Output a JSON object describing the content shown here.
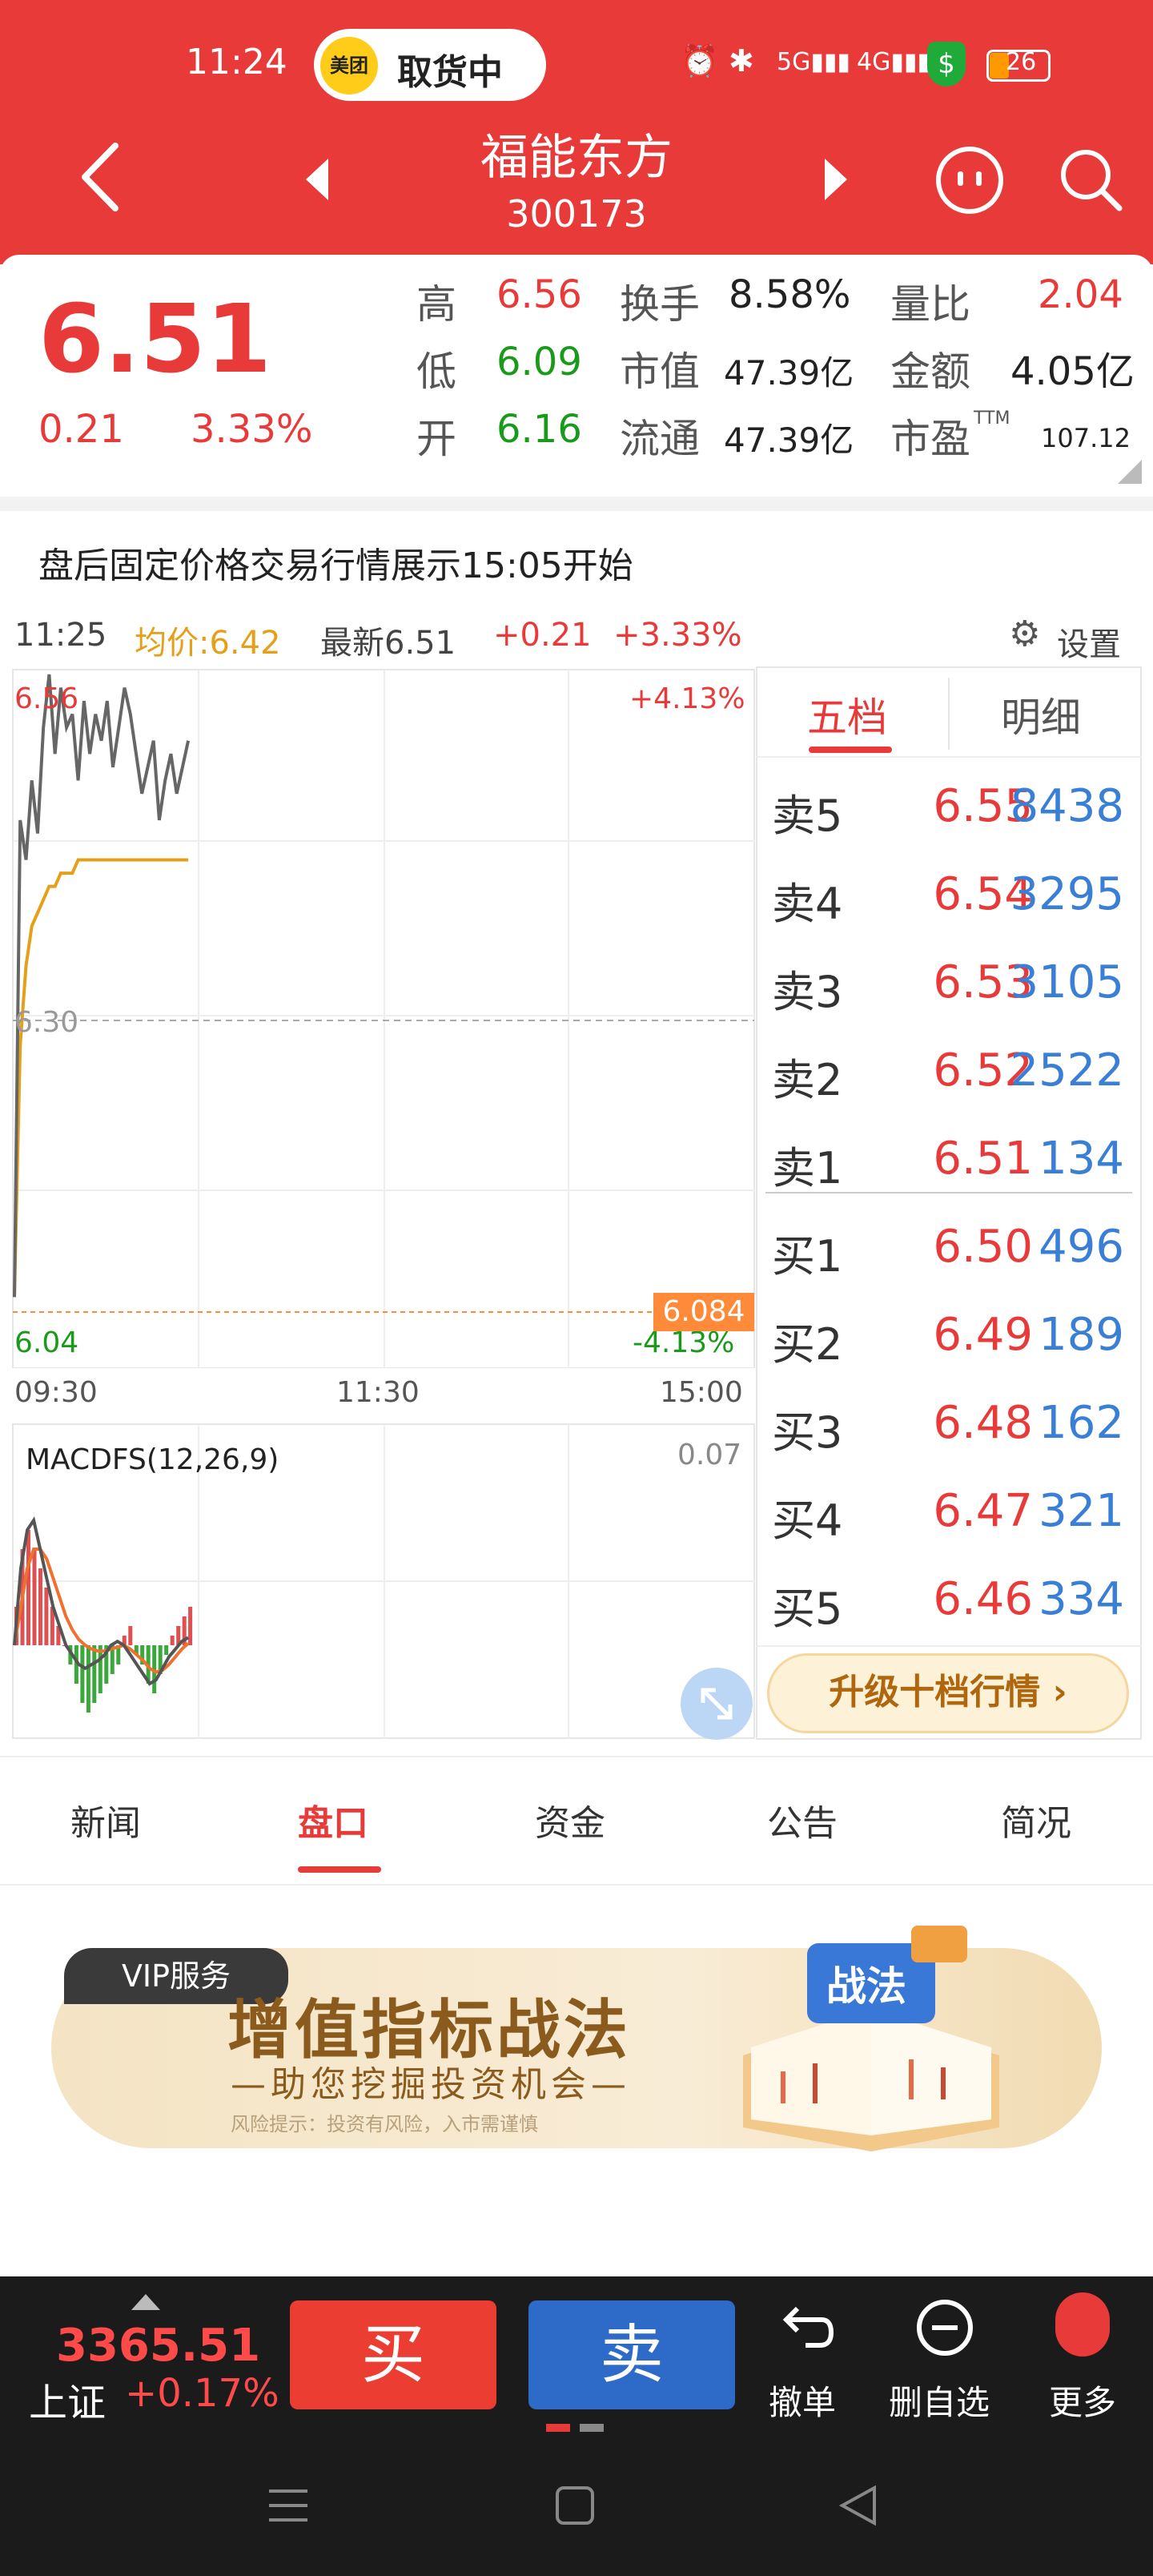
{
  "status_bar": {
    "time": "11:24",
    "pill_logo": "美团",
    "pill_text": "取货中",
    "battery": "26"
  },
  "nav": {
    "title": "福能东方",
    "code": "300173"
  },
  "quote": {
    "price": "6.51",
    "change": "0.21",
    "change_pct": "3.33%",
    "high_label": "高",
    "high": "6.56",
    "low_label": "低",
    "low": "6.09",
    "open_label": "开",
    "open": "6.16",
    "turnover_label": "换手",
    "turnover": "8.58%",
    "mktcap_label": "市值",
    "mktcap": "47.39亿",
    "float_label": "流通",
    "float": "47.39亿",
    "volratio_label": "量比",
    "volratio": "2.04",
    "amount_label": "金额",
    "amount": "4.05亿",
    "pe_label": "市盈",
    "pe_sup": "TTM",
    "pe": "107.12"
  },
  "notice": "盘后固定价格交易行情展示15:05开始",
  "chart_header": {
    "time": "11:25",
    "avg": "均价:6.42",
    "latest": "最新6.51",
    "chg": "+0.21",
    "pct": "+3.33%",
    "settings": "设置"
  },
  "chart_data": {
    "type": "line",
    "title": "",
    "y_top_label": "6.56",
    "y_mid_label": "6.30",
    "y_bottom_label": "6.04",
    "pct_top": "+4.13%",
    "pct_bottom": "-4.13%",
    "ref_price": "6.084",
    "x_ticks": [
      "09:30",
      "11:30",
      "15:00"
    ],
    "ylim": [
      6.04,
      6.56
    ],
    "series": [
      {
        "values": [
          6.09,
          6.45,
          6.42,
          6.48,
          6.44,
          6.52,
          6.56,
          6.5,
          6.55,
          6.52,
          6.53,
          6.48,
          6.54,
          6.5,
          6.53,
          6.51,
          6.54,
          6.49,
          6.52,
          6.55,
          6.53,
          6.5,
          6.47,
          6.49,
          6.51,
          6.45,
          6.48,
          6.5,
          6.47,
          6.49,
          6.51
        ]
      },
      {
        "values": [
          6.09,
          6.28,
          6.34,
          6.37,
          6.38,
          6.39,
          6.4,
          6.4,
          6.41,
          6.41,
          6.41,
          6.42,
          6.42,
          6.42,
          6.42,
          6.42,
          6.42,
          6.42,
          6.42,
          6.42,
          6.42,
          6.42,
          6.42,
          6.42,
          6.42,
          6.42,
          6.42,
          6.42,
          6.42,
          6.42,
          6.42
        ]
      }
    ]
  },
  "macd": {
    "label": "MACDFS(12,26,9)",
    "top_value": "0.07",
    "hist": [
      0.02,
      0.05,
      0.06,
      0.05,
      0.04,
      0.03,
      0.02,
      0.01,
      0.0,
      -0.01,
      -0.02,
      -0.03,
      -0.035,
      -0.03,
      -0.025,
      -0.02,
      -0.015,
      -0.01,
      0.005,
      0.01,
      -0.005,
      -0.01,
      -0.02,
      -0.025,
      -0.015,
      -0.005,
      0.005,
      0.01,
      0.015,
      0.02
    ],
    "dif": [
      0.0,
      0.04,
      0.06,
      0.065,
      0.05,
      0.035,
      0.02,
      0.01,
      0.0,
      -0.005,
      -0.01,
      -0.012,
      -0.01,
      -0.008,
      -0.005,
      0.0,
      0.002,
      0.0,
      -0.005,
      -0.01,
      -0.015,
      -0.02,
      -0.018,
      -0.012,
      -0.006,
      -0.002,
      0.002,
      0.004
    ],
    "dea": [
      0.0,
      0.02,
      0.04,
      0.05,
      0.05,
      0.045,
      0.035,
      0.025,
      0.015,
      0.008,
      0.003,
      0.0,
      -0.002,
      -0.003,
      -0.003,
      -0.002,
      -0.001,
      0.0,
      -0.002,
      -0.005,
      -0.008,
      -0.012,
      -0.014,
      -0.013,
      -0.01,
      -0.006,
      -0.002,
      0.001
    ]
  },
  "order_book": {
    "tabs": [
      "五档",
      "明细"
    ],
    "asks": [
      {
        "label": "卖5",
        "price": "6.55",
        "vol": "8438"
      },
      {
        "label": "卖4",
        "price": "6.54",
        "vol": "3295"
      },
      {
        "label": "卖3",
        "price": "6.53",
        "vol": "3105"
      },
      {
        "label": "卖2",
        "price": "6.52",
        "vol": "2522"
      },
      {
        "label": "卖1",
        "price": "6.51",
        "vol": "134"
      }
    ],
    "bids": [
      {
        "label": "买1",
        "price": "6.50",
        "vol": "496"
      },
      {
        "label": "买2",
        "price": "6.49",
        "vol": "189"
      },
      {
        "label": "买3",
        "price": "6.48",
        "vol": "162"
      },
      {
        "label": "买4",
        "price": "6.47",
        "vol": "321"
      },
      {
        "label": "买5",
        "price": "6.46",
        "vol": "334"
      }
    ],
    "upgrade_label": "升级十档行情 ›"
  },
  "tabs": [
    "新闻",
    "盘口",
    "资金",
    "公告",
    "简况"
  ],
  "banner": {
    "vip": "VIP服务",
    "title": "增值指标战法",
    "subtitle": "—助您挖掘投资机会—",
    "risk": "风险提示：投资有风险，入市需谨慎",
    "book_text": "战法"
  },
  "bottom_bar": {
    "index_value": "3365.51",
    "index_name": "上证",
    "index_pct": "+0.17%",
    "buy": "买",
    "sell": "卖",
    "cancel": "撤单",
    "remove": "删自选",
    "more": "更多"
  },
  "colors": {
    "brand_red": "#e93a3a",
    "green": "#1a9a1a",
    "blue": "#3a7fd6",
    "avg_line": "#e5a01a"
  }
}
